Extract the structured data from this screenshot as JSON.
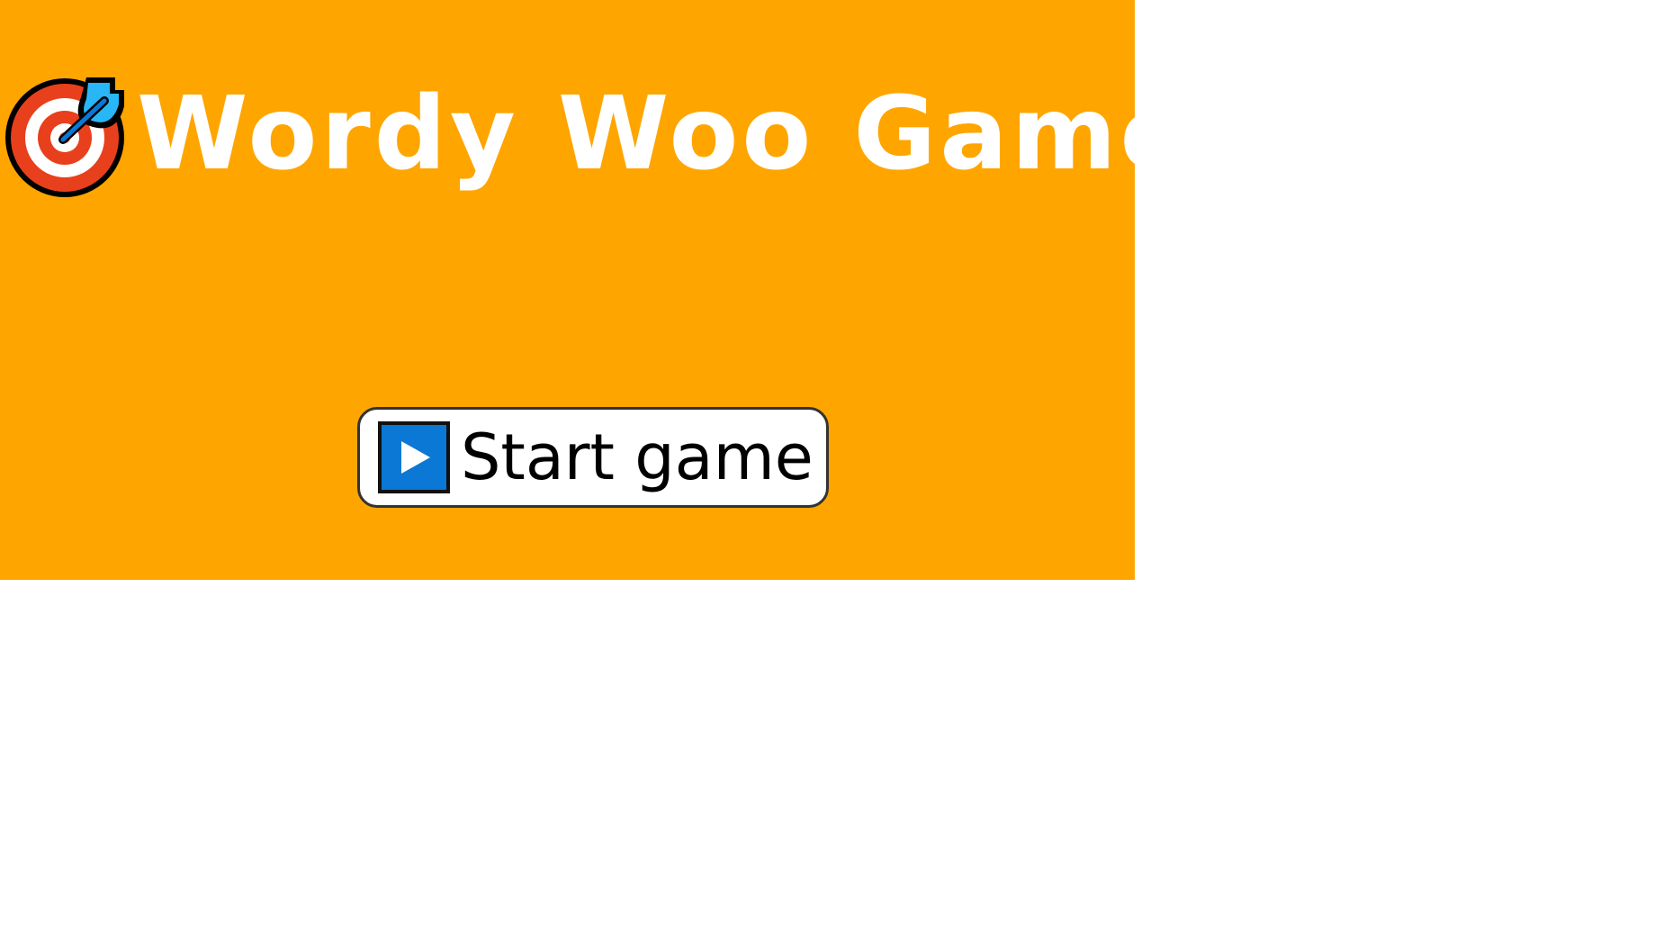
{
  "game": {
    "title": "Wordy Woo Game",
    "title_icon": "target-icon",
    "start_button": {
      "label": "Start game",
      "icon": "play-icon"
    }
  },
  "colors": {
    "panel_background": "#ffa500",
    "title_text": "#ffffff",
    "button_background": "#ffffff",
    "button_border": "#333333",
    "play_icon_background": "#0a78d4",
    "target_red": "#e8401c",
    "target_dart": "#29b6f6"
  }
}
